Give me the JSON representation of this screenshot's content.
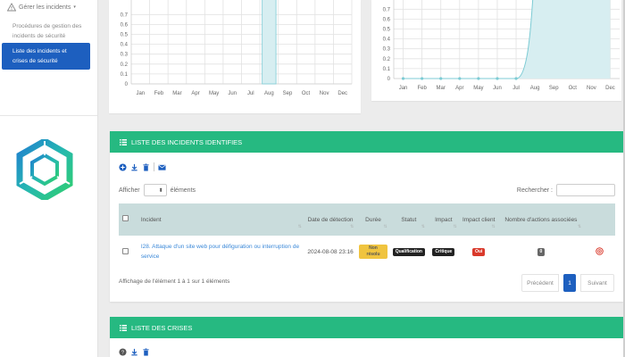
{
  "sidebar": {
    "parent_label": "Gérer les incidents",
    "sub_item_1": "Procédures de gestion des incidents de sécurité",
    "active_item": "Liste des incidents et crises de sécurité"
  },
  "colors": {
    "brand_green": "#26b981",
    "primary_blue": "#1d5fbf",
    "chart_fill": "#d7eef1",
    "chart_line": "#7ccbd4"
  },
  "chart_data": [
    {
      "type": "bar",
      "categories": [
        "Jan",
        "Feb",
        "Mar",
        "Apr",
        "May",
        "Jun",
        "Jul",
        "Aug",
        "Sep",
        "Oct",
        "Nov",
        "Dec"
      ],
      "values": [
        0,
        0,
        0,
        0,
        0,
        0,
        0,
        1,
        0,
        0,
        0,
        0
      ],
      "yticks": [
        "0",
        "0.1",
        "0.2",
        "0.3",
        "0.4",
        "0.5",
        "0.6",
        "0.7"
      ],
      "ylim": [
        0,
        1
      ],
      "grid": true
    },
    {
      "type": "area",
      "categories": [
        "Jan",
        "Feb",
        "Mar",
        "Apr",
        "May",
        "Jun",
        "Jul",
        "Aug",
        "Sep",
        "Oct",
        "Nov",
        "Dec"
      ],
      "values": [
        0,
        0,
        0,
        0,
        0,
        0,
        0,
        1,
        1,
        1,
        1,
        1
      ],
      "yticks": [
        "0",
        "0.1",
        "0.2",
        "0.3",
        "0.4",
        "0.5",
        "0.6",
        "0.7"
      ],
      "ylim": [
        0,
        1
      ],
      "grid": true
    }
  ],
  "incidents": {
    "header_title": "LISTE DES INCIDENTS IDENTIFIES",
    "show_label": "Afficher",
    "entries_label": "éléments",
    "search_label": "Rechercher :",
    "columns": [
      "Incident",
      "Date de détection",
      "Durée",
      "Statut",
      "Impact",
      "Impact client",
      "Nombre d'actions associées"
    ],
    "rows": [
      {
        "incident": "I28. Attaque d'un site web pour défiguration ou interruption de service",
        "date": "2024-08-08 23:16",
        "duree": "Non résolu",
        "statut": "Qualification",
        "impact": "Critique",
        "impact_client": "Oui",
        "actions": "0"
      }
    ],
    "footer_info": "Affichage de l'élément 1 à 1 sur 1 éléments",
    "pager": {
      "prev": "Précédent",
      "page": "1",
      "next": "Suivant"
    }
  },
  "crises": {
    "header_title": "LISTE DES CRISES"
  }
}
